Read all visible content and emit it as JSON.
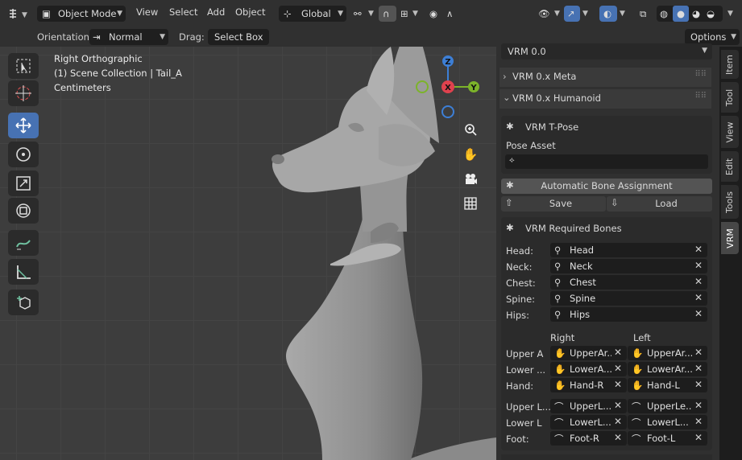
{
  "header": {
    "mode": "Object Mode",
    "menus": [
      "View",
      "Select",
      "Add",
      "Object"
    ],
    "transform_orientation": "Global",
    "orientation_label": "Orientation:",
    "orientation_value": "Normal",
    "drag_label": "Drag:",
    "drag_value": "Select Box",
    "options": "Options"
  },
  "viewport": {
    "view_name": "Right Orthographic",
    "collection": "(1) Scene Collection | Tail_A",
    "units": "Centimeters",
    "gizmo": {
      "z": "Z",
      "x": "X",
      "y": "Y"
    }
  },
  "sidebar": {
    "version": "VRM 0.0",
    "panels": {
      "meta": "VRM 0.x Meta",
      "humanoid": "VRM 0.x Humanoid"
    },
    "tpose": "VRM T-Pose",
    "pose_asset": "Pose Asset",
    "auto_assign": "Automatic Bone Assignment",
    "save": "Save",
    "load": "Load",
    "required_title": "VRM Required Bones",
    "spine_bones": [
      {
        "label": "Head:",
        "value": "Head"
      },
      {
        "label": "Neck:",
        "value": "Neck"
      },
      {
        "label": "Chest:",
        "value": "Chest"
      },
      {
        "label": "Spine:",
        "value": "Spine"
      },
      {
        "label": "Hips:",
        "value": "Hips"
      }
    ],
    "right": "Right",
    "left": "Left",
    "arm_bones": [
      {
        "label": "Upper A",
        "right": "UpperAr...",
        "left": "UpperAr..."
      },
      {
        "label": "Lower ...",
        "right": "LowerA...",
        "left": "LowerAr..."
      },
      {
        "label": "Hand:",
        "right": "Hand-R",
        "left": "Hand-L"
      }
    ],
    "leg_bones": [
      {
        "label": "Upper L...",
        "right": "UpperL...",
        "left": "UpperLe..."
      },
      {
        "label": "Lower L",
        "right": "LowerL...",
        "left": "LowerL..."
      },
      {
        "label": "Foot:",
        "right": "Foot-R",
        "left": "Foot-L"
      }
    ]
  },
  "tabs": [
    "Item",
    "Tool",
    "View",
    "Edit",
    "Tools",
    "VRM"
  ],
  "colors": {
    "active_tool": "#4772b3",
    "axis_x": "#e0424e",
    "axis_y": "#7cb32a",
    "axis_z": "#3d7fd6"
  }
}
